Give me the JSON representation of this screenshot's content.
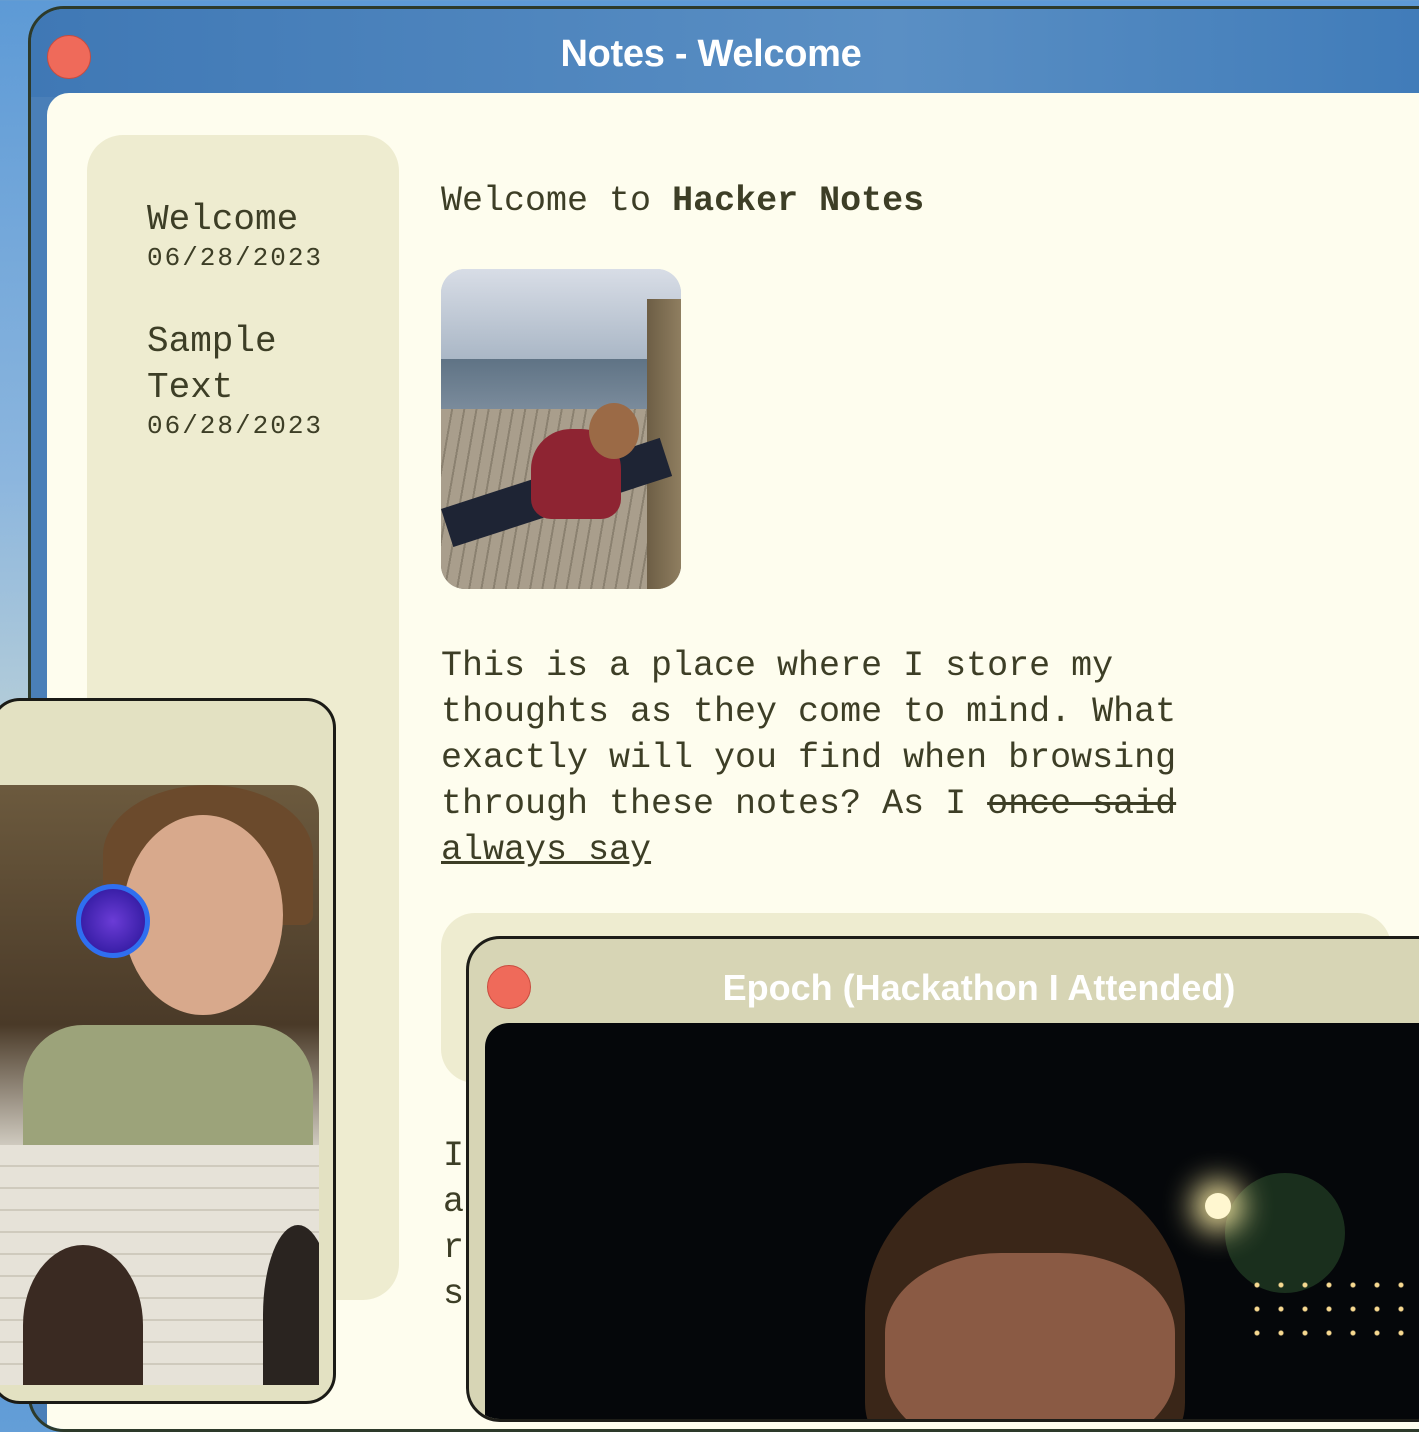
{
  "notes_window": {
    "title": "Notes - Welcome",
    "sidebar": {
      "items": [
        {
          "title": "Welcome",
          "date": "06/28/2023"
        },
        {
          "title_line1": "Sample",
          "title_line2": "Text",
          "date": "06/28/2023"
        }
      ]
    },
    "note": {
      "heading_prefix": "Welcome to",
      "heading_bold": "Hacker Notes",
      "paragraph_line1": "This is a place where I store my",
      "paragraph_line2": "thoughts as they come to mind. What",
      "paragraph_line3": "exactly will you find when browsing",
      "paragraph_line4_prefix": "through these notes? As I",
      "strikethrough_text": "once said",
      "underlined_text": "always say",
      "cut_text_lines": [
        "I",
        "a",
        "r",
        "s"
      ]
    }
  },
  "epoch_window": {
    "title": "Epoch (Hackathon I Attended)"
  },
  "colors": {
    "titlebar": "#4a7fb8",
    "content_bg": "#fefdee",
    "sidebar_bg": "#eeecd0",
    "text": "#3d3e26",
    "close_button": "#ef6a5a"
  }
}
